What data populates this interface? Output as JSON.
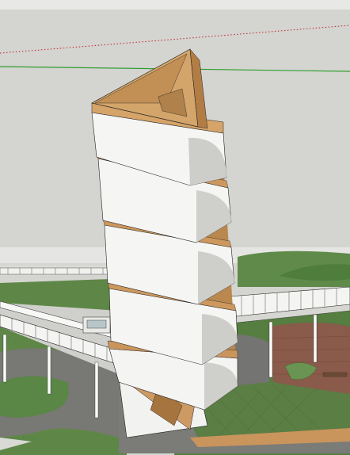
{
  "app": {
    "scene": "sketchup-model-viewport",
    "style": "shaded-with-textures-and-edges"
  },
  "toolbar": {
    "visible": true,
    "labels": []
  },
  "canvas": {
    "sky_color": "#d4d4d0",
    "axes": {
      "red_axis_color": "#c0262a",
      "green_axis_color": "#2f9e2f",
      "red_axis_style": "dotted",
      "green_axis_style": "solid"
    },
    "colors": {
      "tower_wall": "#f3f3f3",
      "tower_shadow": "#c7c7c7",
      "timber_floor": "#d3a56a",
      "grass": "#5f8a4a",
      "paving": "#7a7a78",
      "brick_plaza": "#8a5a4a",
      "edge_lines": "#1d1d1d"
    },
    "icons": [
      "tower-model-icon",
      "ramp-bridge-icon",
      "plaza-icon"
    ]
  }
}
